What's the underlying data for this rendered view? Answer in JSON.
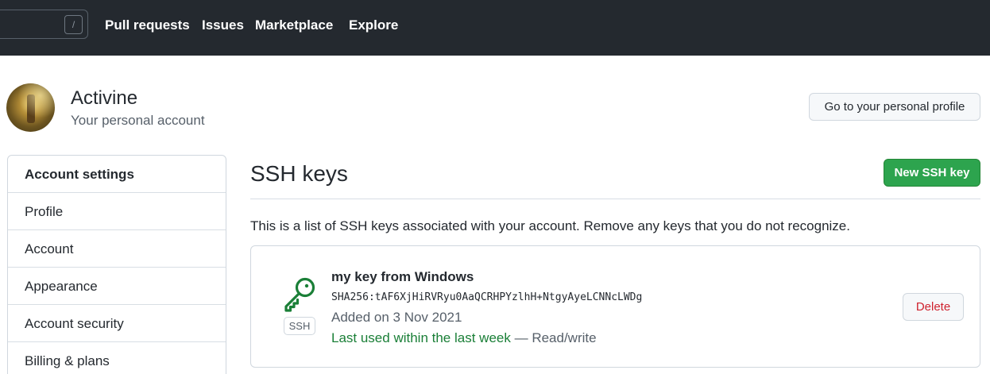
{
  "topnav": {
    "search_hotkey": "/",
    "links": [
      "Pull requests",
      "Issues",
      "Marketplace",
      "Explore"
    ]
  },
  "header": {
    "name": "Activine",
    "subtitle": "Your personal account",
    "profile_button": "Go to your personal profile"
  },
  "sidebar": {
    "heading": "Account settings",
    "items": [
      "Profile",
      "Account",
      "Appearance",
      "Account security",
      "Billing & plans"
    ]
  },
  "main": {
    "title": "SSH keys",
    "new_button": "New SSH key",
    "intro": "This is a list of SSH keys associated with your account. Remove any keys that you do not recognize.",
    "keys": [
      {
        "badge": "SSH",
        "title": "my key from Windows",
        "fingerprint": "SHA256:tAF6XjHiRVRyu0AaQCRHPYzlhH+NtgyAyeLCNNcLWDg",
        "added": "Added on 3 Nov 2021",
        "last_used": "Last used within the last week",
        "access": "— Read/write",
        "delete_button": "Delete"
      }
    ]
  },
  "colors": {
    "topbar": "#24292f",
    "primary_button": "#2da44e",
    "danger_text": "#cf222e",
    "recent_text": "#1a7f37"
  }
}
